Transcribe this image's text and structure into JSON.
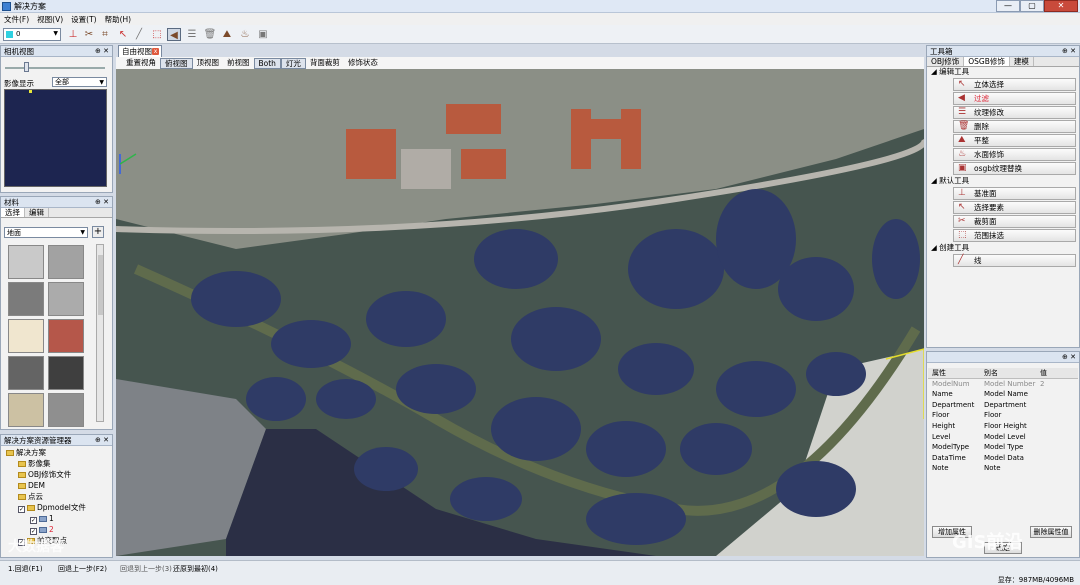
{
  "window": {
    "title": "解决方案",
    "btn_minimize": "—",
    "btn_maximize": "▢",
    "btn_close": "✕"
  },
  "menu": [
    "文件(F)",
    "视图(V)",
    "设置(T)",
    "帮助(H)"
  ],
  "toolbar": {
    "layer_value": "0"
  },
  "camera_panel": {
    "title": "相机视图",
    "image_display_label": "影像显示",
    "image_display_value": "全部"
  },
  "material_panel": {
    "title": "材料",
    "tabs": [
      "选择",
      "编辑"
    ],
    "category": "地面",
    "add_label": "+",
    "swatch_colors": [
      "#c9c9c9",
      "#a2a2a2",
      "#7b7b7b",
      "#ababab",
      "#f0e6cf",
      "#b5574a",
      "#646464",
      "#3f3f3f",
      "#ccc1a3",
      "#8f8f8f"
    ]
  },
  "solution_panel": {
    "title": "解决方案资源管理器",
    "tree": [
      {
        "label": "解决方案",
        "depth": 0,
        "checked": null
      },
      {
        "label": "影像集",
        "depth": 1,
        "checked": null
      },
      {
        "label": "OBJ修饰文件",
        "depth": 1,
        "checked": null
      },
      {
        "label": "DEM",
        "depth": 1,
        "checked": null
      },
      {
        "label": "点云",
        "depth": 1,
        "checked": null
      },
      {
        "label": "Dpmodel文件",
        "depth": 1,
        "checked": true
      },
      {
        "label": "1",
        "depth": 2,
        "checked": true
      },
      {
        "label": "2",
        "depth": 2,
        "checked": true
      },
      {
        "label": "前交取点",
        "depth": 1,
        "checked": true
      }
    ]
  },
  "viewport": {
    "tab_label": "自由视图",
    "toolbar": [
      {
        "label": "重置视角",
        "active": false
      },
      {
        "label": "俯视图",
        "active": true
      },
      {
        "label": "顶视图",
        "active": false
      },
      {
        "label": "前视图",
        "active": false
      },
      {
        "label": "Both",
        "active": true
      },
      {
        "label": "灯光",
        "active": true
      },
      {
        "label": "背面裁剪",
        "active": false
      },
      {
        "label": "修饰状态",
        "active": false
      }
    ]
  },
  "toolbox": {
    "title": "工具箱",
    "tabs": [
      "OBJ修饰",
      "OSGB修饰",
      "建模"
    ],
    "sections": [
      {
        "title": "编辑工具",
        "items": [
          "立体选择",
          "过滤",
          "纹理修改",
          "删除",
          "平整",
          "水面修饰",
          "osgb纹理替换"
        ]
      },
      {
        "title": "默认工具",
        "items": [
          "基准面",
          "选择要素",
          "裁剪面",
          "范围抹选"
        ]
      },
      {
        "title": "创建工具",
        "items": [
          "线"
        ]
      }
    ]
  },
  "properties": {
    "headers": [
      "属性",
      "别名",
      "值"
    ],
    "rows": [
      {
        "name": "ModelNum",
        "alias": "Model Number",
        "value": "2",
        "dim": true
      },
      {
        "name": "Name",
        "alias": "Model Name",
        "value": "",
        "dim": false
      },
      {
        "name": "Department",
        "alias": "Department",
        "value": "",
        "dim": false
      },
      {
        "name": "Floor",
        "alias": "Floor",
        "value": "",
        "dim": false
      },
      {
        "name": "Height",
        "alias": "Floor Height",
        "value": "",
        "dim": false
      },
      {
        "name": "Level",
        "alias": "Model Level",
        "value": "",
        "dim": false
      },
      {
        "name": "ModelType",
        "alias": "Model Type",
        "value": "",
        "dim": false
      },
      {
        "name": "DataTime",
        "alias": "Model Data",
        "value": "",
        "dim": false
      },
      {
        "name": "Note",
        "alias": "Note",
        "value": "",
        "dim": false
      }
    ],
    "btn_add": "增加属性",
    "btn_delete": "删除属性值",
    "btn_ok": "确定"
  },
  "status": {
    "items": [
      "1.回退(F1)",
      "回退上一步(F2)",
      "回退到上一步(3)",
      "还原到最初(4)"
    ],
    "memory": "显存：987MB/4096MB"
  },
  "watermarks": {
    "left": "大数据客",
    "right": "GIS前沿"
  }
}
